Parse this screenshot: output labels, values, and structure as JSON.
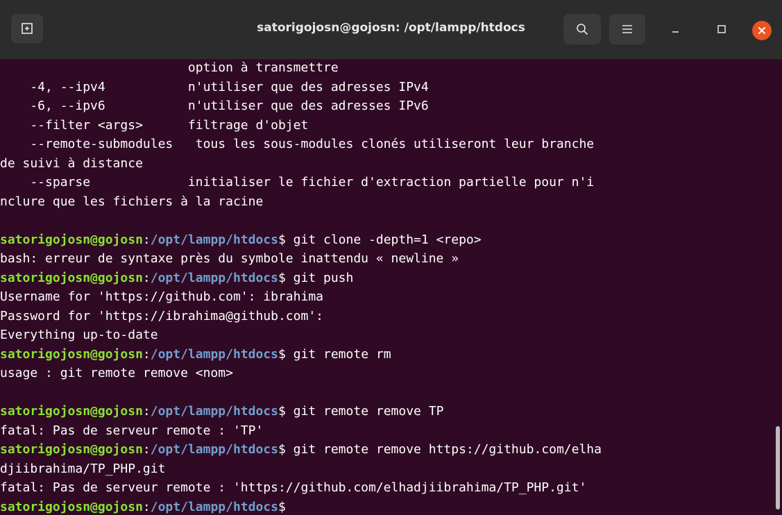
{
  "window": {
    "title": "satorigojosn@gojosn: /opt/lampp/htdocs"
  },
  "colors": {
    "background": "#300a24",
    "user": "#8ae234",
    "path": "#729fcf",
    "text": "#ffffff",
    "close": "#e95420"
  },
  "icons": {
    "newtab": "new-tab-icon",
    "search": "search-icon",
    "menu": "hamburger-menu-icon",
    "minimize": "minimize-icon",
    "maximize": "maximize-icon",
    "close": "close-icon"
  },
  "terminal": {
    "prompt_user": "satorigojosn@gojosn",
    "prompt_colon": ":",
    "prompt_path": "/opt/lampp/htdocs",
    "prompt_dollar": "$",
    "lines": [
      {
        "type": "out",
        "text": "                         option à transmettre"
      },
      {
        "type": "out",
        "text": "    -4, --ipv4           n'utiliser que des adresses IPv4"
      },
      {
        "type": "out",
        "text": "    -6, --ipv6           n'utiliser que des adresses IPv6"
      },
      {
        "type": "out",
        "text": "    --filter <args>      filtrage d'objet"
      },
      {
        "type": "out",
        "text": "    --remote-submodules   tous les sous-modules clonés utiliseront leur branche"
      },
      {
        "type": "out",
        "text": "de suivi à distance"
      },
      {
        "type": "out",
        "text": "    --sparse             initialiser le fichier d'extraction partielle pour n'i"
      },
      {
        "type": "out",
        "text": "nclure que les fichiers à la racine"
      },
      {
        "type": "out",
        "text": ""
      },
      {
        "type": "prompt",
        "text": " git clone -depth=1 <repo>"
      },
      {
        "type": "out",
        "text": "bash: erreur de syntaxe près du symbole inattendu « newline »"
      },
      {
        "type": "prompt",
        "text": " git push"
      },
      {
        "type": "out",
        "text": "Username for 'https://github.com': ibrahima"
      },
      {
        "type": "out",
        "text": "Password for 'https://ibrahima@github.com':"
      },
      {
        "type": "out",
        "text": "Everything up-to-date"
      },
      {
        "type": "prompt",
        "text": " git remote rm"
      },
      {
        "type": "out",
        "text": "usage : git remote remove <nom>"
      },
      {
        "type": "out",
        "text": ""
      },
      {
        "type": "prompt",
        "text": " git remote remove TP"
      },
      {
        "type": "out",
        "text": "fatal: Pas de serveur remote : 'TP'"
      },
      {
        "type": "prompt",
        "text": " git remote remove https://github.com/elha"
      },
      {
        "type": "out",
        "text": "djiibrahima/TP_PHP.git"
      },
      {
        "type": "out",
        "text": "fatal: Pas de serveur remote : 'https://github.com/elhadjiibrahima/TP_PHP.git'"
      },
      {
        "type": "prompt",
        "text": ""
      }
    ]
  }
}
